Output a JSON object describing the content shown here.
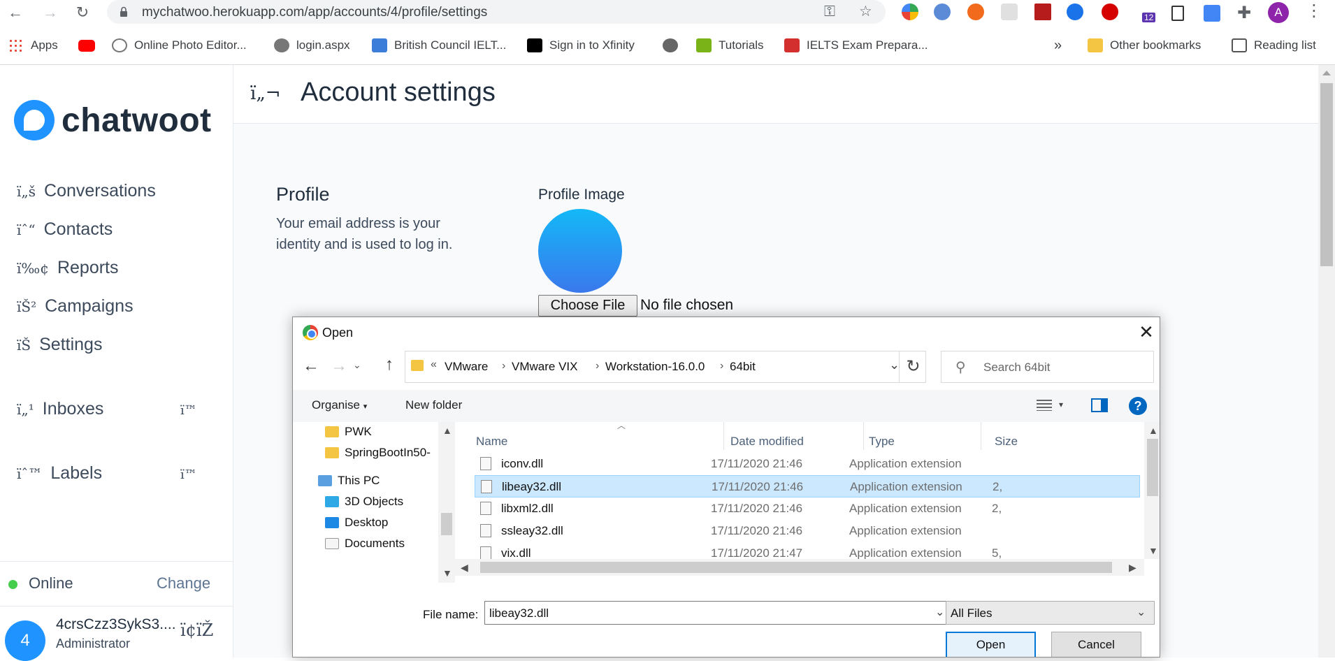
{
  "browser": {
    "url": "mychatwoo.herokuapp.com/app/accounts/4/profile/settings",
    "ext_badge": "12",
    "profile_initial": "A",
    "bookmarks": [
      {
        "label": "Apps",
        "icon": "apps-grid-icon",
        "color": "#ea4335"
      },
      {
        "label": "",
        "icon": "youtube-icon",
        "color": "#ff0000"
      },
      {
        "label": "Online Photo Editor...",
        "icon": "camera-aperture-icon",
        "color": "#777777"
      },
      {
        "label": "login.aspx",
        "icon": "globe-icon",
        "color": "#666666"
      },
      {
        "label": "British Council IELT...",
        "icon": "british-council-icon",
        "color": "#3c7dd9"
      },
      {
        "label": "Sign in to Xfinity",
        "icon": "xfinity-icon",
        "color": "#000000"
      },
      {
        "label": "",
        "icon": "globe-icon",
        "color": "#666666"
      },
      {
        "label": "Tutorials",
        "icon": "tutorials-icon",
        "color": "#7ab317"
      },
      {
        "label": "IELTS Exam Prepara...",
        "icon": "ielts-icon",
        "color": "#d32f2f"
      }
    ],
    "overflow": "»",
    "other_bookmarks": "Other bookmarks",
    "reading_list": "Reading list"
  },
  "sidebar": {
    "brand": "chatwoot",
    "items": [
      {
        "glyph": "ï„š",
        "label": "Conversations"
      },
      {
        "glyph": "ïˆ“",
        "label": "Contacts"
      },
      {
        "glyph": "ï‰¢",
        "label": "Reports"
      },
      {
        "glyph": "ïŠ²",
        "label": "Campaigns"
      },
      {
        "glyph": "ïŠ",
        "label": "Settings"
      }
    ],
    "sections": [
      {
        "glyph": "ï„¹",
        "label": "Inboxes",
        "action_glyph": "ï™"
      },
      {
        "glyph": "ïˆ™",
        "label": "Labels",
        "action_glyph": "ï™"
      }
    ],
    "status": "Online",
    "change": "Change",
    "user": {
      "initial": "4",
      "name": "4crsCzz3SykS3....",
      "role": "Administrator",
      "glyph": "ï¢ïŽ"
    }
  },
  "page": {
    "header_glyph": "ï„¬",
    "title": "Account settings",
    "profile_title": "Profile",
    "profile_desc": "Your email address is your identity and is used to log in.",
    "image_label": "Profile Image",
    "choose_file": "Choose File",
    "no_file": "No file chosen"
  },
  "dialog": {
    "title": "Open",
    "breadcrumbs": [
      "VMware",
      "VMware VIX",
      "Workstation-16.0.0",
      "64bit"
    ],
    "breadcrumb_prefix": "«",
    "search_placeholder": "Search 64bit",
    "organise": "Organise",
    "new_folder": "New folder",
    "nav_items": [
      {
        "label": "PWK",
        "icon": "folder-icon"
      },
      {
        "label": "SpringBootIn50-",
        "icon": "folder-icon"
      },
      {
        "label": "This PC",
        "icon": "computer-icon"
      },
      {
        "label": "3D Objects",
        "icon": "cube-icon"
      },
      {
        "label": "Desktop",
        "icon": "desktop-icon"
      },
      {
        "label": "Documents",
        "icon": "documents-icon"
      }
    ],
    "columns": {
      "name": "Name",
      "date": "Date modified",
      "type": "Type",
      "size": "Size"
    },
    "files": [
      {
        "name": "iconv.dll",
        "date": "17/11/2020 21:46",
        "type": "Application extension",
        "size": ""
      },
      {
        "name": "libeay32.dll",
        "date": "17/11/2020 21:46",
        "type": "Application extension",
        "size": "2,"
      },
      {
        "name": "libxml2.dll",
        "date": "17/11/2020 21:46",
        "type": "Application extension",
        "size": "2,"
      },
      {
        "name": "ssleay32.dll",
        "date": "17/11/2020 21:46",
        "type": "Application extension",
        "size": ""
      },
      {
        "name": "vix.dll",
        "date": "17/11/2020 21:47",
        "type": "Application extension",
        "size": "5,"
      }
    ],
    "selected_file": "libeay32.dll",
    "file_name_label": "File name:",
    "file_name_value": "libeay32.dll",
    "filter": "All Files",
    "open_button": "Open",
    "cancel_button": "Cancel"
  },
  "colors": {
    "accent": "#1f93ff",
    "online": "#44ce4b",
    "selection": "#cce8ff",
    "windows_blue": "#0067c0"
  }
}
